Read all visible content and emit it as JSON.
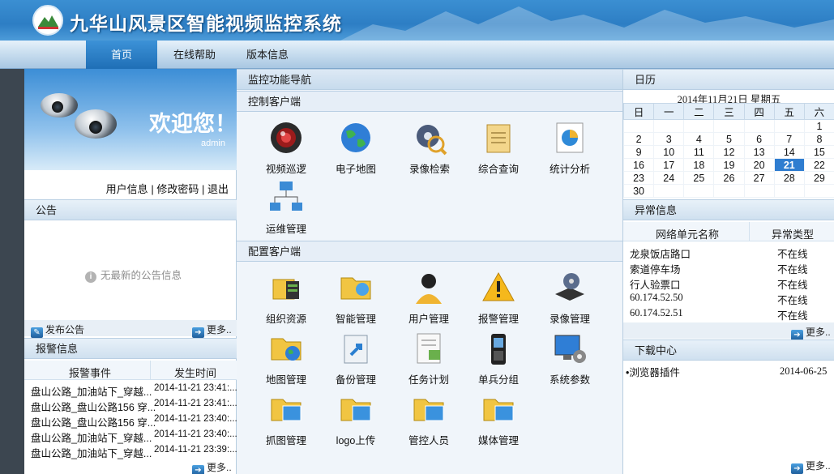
{
  "header": {
    "title": "九华山风景区智能视频监控系统"
  },
  "nav": {
    "items": [
      "首页",
      "在线帮助",
      "版本信息"
    ]
  },
  "welcome": {
    "greeting": "欢迎您！",
    "username": "admin"
  },
  "user_links": {
    "info": "用户信息",
    "password": "修改密码",
    "logout": "退出",
    "sep": "|"
  },
  "notice": {
    "title": "公告",
    "empty_text": "无最新的公告信息",
    "publish_label": "发布公告",
    "more_label": "更多.."
  },
  "alarm": {
    "title": "报警信息",
    "columns": [
      "报警事件",
      "发生时间"
    ],
    "rows": [
      {
        "event": "盘山公路_加油站下_穿越...",
        "time": "2014-11-21 23:41:..."
      },
      {
        "event": "盘山公路_盘山公路156 穿...",
        "time": "2014-11-21 23:41:..."
      },
      {
        "event": "盘山公路_盘山公路156 穿...",
        "time": "2014-11-21 23:40:..."
      },
      {
        "event": "盘山公路_加油站下_穿越...",
        "time": "2014-11-21 23:40:..."
      },
      {
        "event": "盘山公路_加油站下_穿越...",
        "time": "2014-11-21 23:39:..."
      }
    ],
    "more_label": "更多.."
  },
  "monitor": {
    "title": "监控功能导航",
    "control_title": "控制客户端",
    "control_items": [
      {
        "label": "视频巡逻",
        "icon": "camera-icon"
      },
      {
        "label": "电子地图",
        "icon": "globe-icon"
      },
      {
        "label": "录像检索",
        "icon": "film-search-icon"
      },
      {
        "label": "综合查询",
        "icon": "notepad-icon"
      },
      {
        "label": "统计分析",
        "icon": "pie-chart-icon"
      },
      {
        "label": "运维管理",
        "icon": "network-icon"
      }
    ],
    "config_title": "配置客户端",
    "config_items": [
      {
        "label": "组织资源",
        "icon": "server-folder-icon"
      },
      {
        "label": "智能管理",
        "icon": "folder-person-icon"
      },
      {
        "label": "用户管理",
        "icon": "user-icon"
      },
      {
        "label": "报警管理",
        "icon": "warning-icon"
      },
      {
        "label": "录像管理",
        "icon": "film-reel-icon"
      },
      {
        "label": "地图管理",
        "icon": "folder-globe-icon"
      },
      {
        "label": "备份管理",
        "icon": "backup-icon"
      },
      {
        "label": "任务计划",
        "icon": "task-list-icon"
      },
      {
        "label": "单兵分组",
        "icon": "handset-icon"
      },
      {
        "label": "系统参数",
        "icon": "monitor-gear-icon"
      },
      {
        "label": "抓图管理",
        "icon": "folder-image-icon"
      },
      {
        "label": "logo上传",
        "icon": "folder-image-icon"
      },
      {
        "label": "管控人员",
        "icon": "folder-image-icon"
      },
      {
        "label": "媒体管理",
        "icon": "folder-image-icon"
      }
    ]
  },
  "calendar": {
    "title": "日历",
    "date_text": "2014年11月21日 星期五",
    "weekdays": [
      "日",
      "一",
      "二",
      "三",
      "四",
      "五",
      "六"
    ],
    "weeks": [
      [
        "",
        "",
        "",
        "",
        "",
        "",
        "1"
      ],
      [
        "2",
        "3",
        "4",
        "5",
        "6",
        "7",
        "8"
      ],
      [
        "9",
        "10",
        "11",
        "12",
        "13",
        "14",
        "15"
      ],
      [
        "16",
        "17",
        "18",
        "19",
        "20",
        "21",
        "22"
      ],
      [
        "23",
        "24",
        "25",
        "26",
        "27",
        "28",
        "29"
      ],
      [
        "30",
        "",
        "",
        "",
        "",
        "",
        ""
      ]
    ],
    "today": "21"
  },
  "abnormal": {
    "title": "异常信息",
    "columns": [
      "网络单元名称",
      "异常类型"
    ],
    "rows": [
      {
        "name": "龙泉饭店路口",
        "type": "不在线"
      },
      {
        "name": "索道停车场",
        "type": "不在线"
      },
      {
        "name": "行人验票口",
        "type": "不在线"
      },
      {
        "name": "60.174.52.50",
        "type": "不在线"
      },
      {
        "name": "60.174.52.51",
        "type": "不在线"
      }
    ],
    "more_label": "更多.."
  },
  "download": {
    "title": "下载中心",
    "items": [
      {
        "name": "浏览器插件",
        "date": "2014-06-25"
      }
    ],
    "more_label": "更多.."
  }
}
